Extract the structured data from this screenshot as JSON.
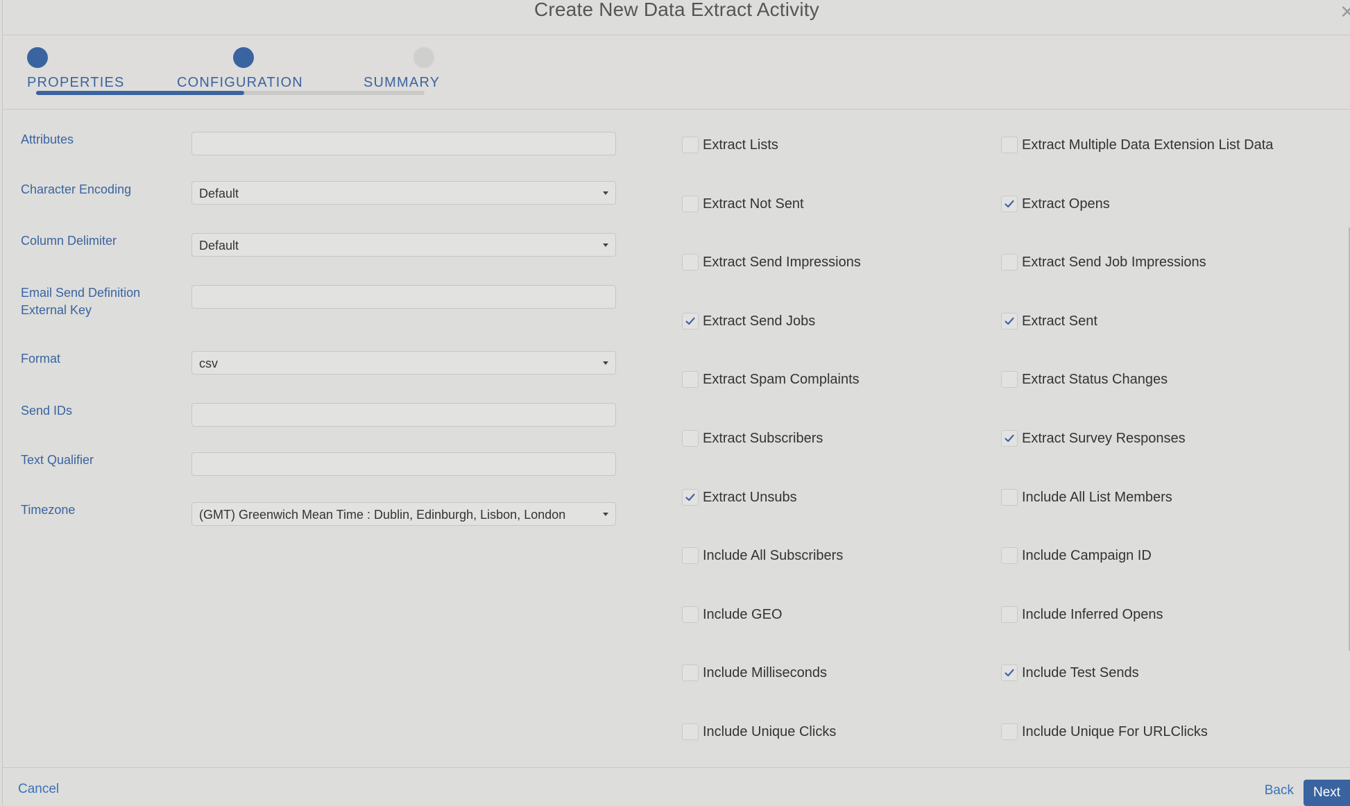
{
  "dialog": {
    "title": "Create New Data Extract Activity",
    "close_icon": "close-icon"
  },
  "steps": [
    {
      "label": "PROPERTIES",
      "state": "complete"
    },
    {
      "label": "CONFIGURATION",
      "state": "current"
    },
    {
      "label": "SUMMARY",
      "state": "pending"
    }
  ],
  "form": {
    "attributes": {
      "label": "Attributes",
      "value": ""
    },
    "character_encoding": {
      "label": "Character Encoding",
      "value": "Default"
    },
    "column_delimiter": {
      "label": "Column Delimiter",
      "value": "Default"
    },
    "email_send_definition": {
      "label_line1": "Email Send Definition",
      "label_line2": "External Key",
      "value": ""
    },
    "format": {
      "label": "Format",
      "value": "csv"
    },
    "send_ids": {
      "label": "Send IDs",
      "value": ""
    },
    "text_qualifier": {
      "label": "Text Qualifier",
      "value": ""
    },
    "timezone": {
      "label": "Timezone",
      "value": "(GMT) Greenwich Mean Time : Dublin, Edinburgh, Lisbon, London"
    }
  },
  "options": [
    {
      "label": "Extract Lists",
      "checked": false
    },
    {
      "label": "Extract Multiple Data Extension List Data",
      "checked": false
    },
    {
      "label": "Extract Not Sent",
      "checked": false
    },
    {
      "label": "Extract Opens",
      "checked": true
    },
    {
      "label": "Extract Send Impressions",
      "checked": false
    },
    {
      "label": "Extract Send Job Impressions",
      "checked": false
    },
    {
      "label": "Extract Send Jobs",
      "checked": true
    },
    {
      "label": "Extract Sent",
      "checked": true
    },
    {
      "label": "Extract Spam Complaints",
      "checked": false
    },
    {
      "label": "Extract Status Changes",
      "checked": false
    },
    {
      "label": "Extract Subscribers",
      "checked": false
    },
    {
      "label": "Extract Survey Responses",
      "checked": true
    },
    {
      "label": "Extract Unsubs",
      "checked": true
    },
    {
      "label": "Include All List Members",
      "checked": false
    },
    {
      "label": "Include All Subscribers",
      "checked": false
    },
    {
      "label": "Include Campaign ID",
      "checked": false
    },
    {
      "label": "Include GEO",
      "checked": false
    },
    {
      "label": "Include Inferred Opens",
      "checked": false
    },
    {
      "label": "Include Milliseconds",
      "checked": false
    },
    {
      "label": "Include Test Sends",
      "checked": true
    },
    {
      "label": "Include Unique Clicks",
      "checked": false
    },
    {
      "label": "Include Unique For URLClicks",
      "checked": false
    }
  ],
  "footer": {
    "cancel_label": "Cancel",
    "back_label": "Back",
    "next_label": "Next"
  },
  "colors": {
    "accent": "#3a64a0",
    "link": "#3a72b8",
    "background": "#dddddb"
  }
}
